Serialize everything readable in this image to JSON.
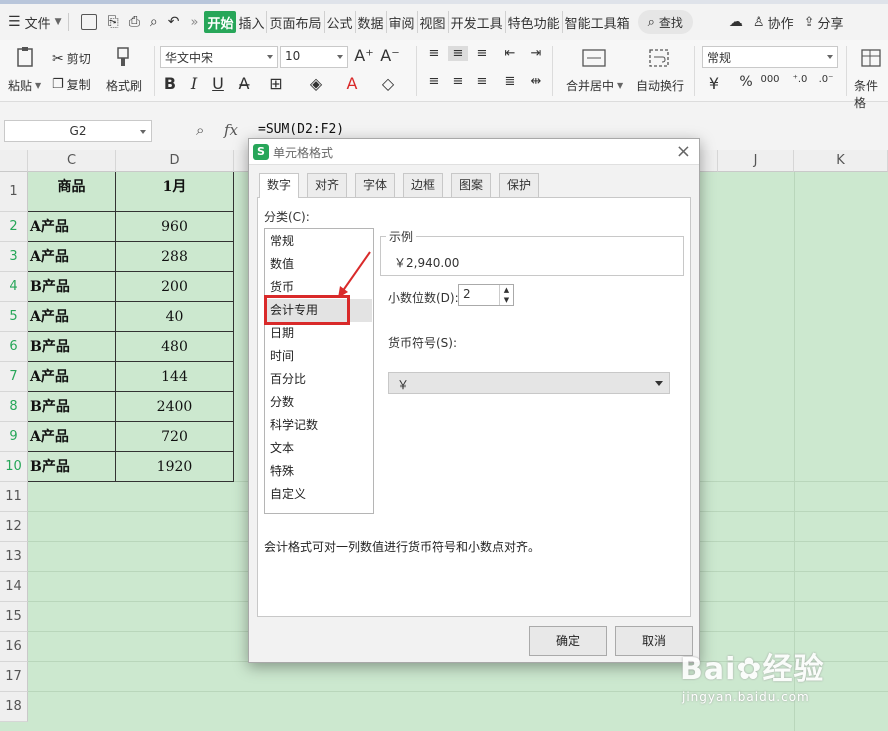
{
  "menubar": {
    "file_label": "文件",
    "tabs": [
      "开始",
      "插入",
      "页面布局",
      "公式",
      "数据",
      "审阅",
      "视图",
      "开发工具",
      "特色功能",
      "智能工具箱"
    ],
    "search_label": "查找",
    "collab_label": "协作",
    "share_label": "分享"
  },
  "ribbon": {
    "paste_label": "粘贴",
    "cut_label": "剪切",
    "copy_label": "复制",
    "format_painter_label": "格式刷",
    "font_name": "华文中宋",
    "font_size": "10",
    "merge_label": "合并居中",
    "wrap_label": "自动换行",
    "number_format": "常规",
    "percent": "%",
    "cond_format_label": "条件格"
  },
  "formula_bar": {
    "name_box": "G2",
    "fx_label": "fx",
    "formula": "=SUM(D2:F2)"
  },
  "grid": {
    "columns": [
      "C",
      "D",
      "J",
      "K"
    ],
    "rows": [
      "1",
      "2",
      "3",
      "4",
      "5",
      "6",
      "7",
      "8",
      "9",
      "10",
      "11",
      "12",
      "13",
      "14",
      "15",
      "16",
      "17",
      "18"
    ],
    "header": {
      "c": "商品",
      "d": "1月"
    },
    "data": [
      {
        "c": "A产品",
        "d": "960"
      },
      {
        "c": "A产品",
        "d": "288"
      },
      {
        "c": "B产品",
        "d": "200"
      },
      {
        "c": "A产品",
        "d": "40"
      },
      {
        "c": "B产品",
        "d": "480"
      },
      {
        "c": "A产品",
        "d": "144"
      },
      {
        "c": "B产品",
        "d": "2400"
      },
      {
        "c": "A产品",
        "d": "720"
      },
      {
        "c": "B产品",
        "d": "1920"
      }
    ]
  },
  "dialog": {
    "title": "单元格格式",
    "tabs": [
      "数字",
      "对齐",
      "字体",
      "边框",
      "图案",
      "保护"
    ],
    "category_label": "分类(C):",
    "categories": [
      "常规",
      "数值",
      "货币",
      "会计专用",
      "日期",
      "时间",
      "百分比",
      "分数",
      "科学记数",
      "文本",
      "特殊",
      "自定义"
    ],
    "selected_category": "会计专用",
    "sample_legend": "示例",
    "sample_value": "￥2,940.00",
    "decimal_label": "小数位数(D):",
    "decimal_value": "2",
    "currency_label": "货币符号(S):",
    "currency_value": "￥",
    "description": "会计格式可对一列数值进行货币符号和小数点对齐。",
    "ok_label": "确定",
    "cancel_label": "取消",
    "highlight_color": "#d92a2a"
  },
  "watermark": {
    "brand": "Bai",
    "brand2": "经验",
    "url": "jingyan.baidu.com"
  },
  "colors": {
    "accent": "#27a659",
    "sheet_bg": "#cce8cf"
  }
}
